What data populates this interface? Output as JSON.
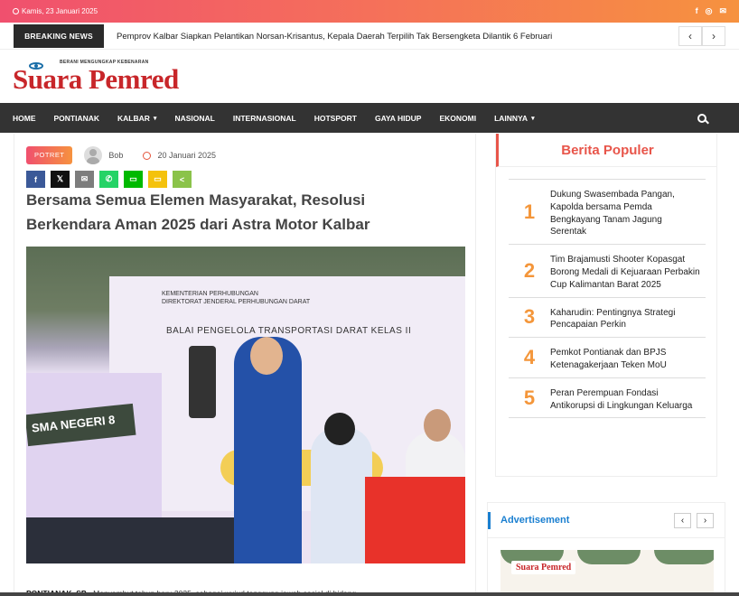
{
  "topbar": {
    "date": "Kamis, 23 Januari 2025",
    "social": [
      "f",
      "◎",
      "✉"
    ]
  },
  "breaking": {
    "label": "BREAKING NEWS",
    "text": "Pemprov Kalbar Siapkan Pelantikan Norsan-Krisantus, Kepala Daerah Terpilih Tak Bersengketa Dilantik 6 Februari",
    "prev": "‹",
    "next": "›"
  },
  "logo": {
    "tagline": "BERANI MENGUNGKAP KEBENARAN",
    "name": "Suara Pemred"
  },
  "nav": {
    "items": [
      {
        "label": "HOME"
      },
      {
        "label": "PONTIANAK"
      },
      {
        "label": "KALBAR",
        "dropdown": "▾"
      },
      {
        "label": "NASIONAL"
      },
      {
        "label": "INTERNASIONAL"
      },
      {
        "label": "HOTSPORT"
      },
      {
        "label": "GAYA HIDUP"
      },
      {
        "label": "EKONOMI"
      },
      {
        "label": "LAINNYA",
        "dropdown": "▾"
      }
    ]
  },
  "article": {
    "category": "POTRET",
    "author": "Bob",
    "date": "20 Januari 2025",
    "share": [
      {
        "icon": "facebook-icon",
        "glyph": "f",
        "color": "#3b5998"
      },
      {
        "icon": "x-icon",
        "glyph": "𝕏",
        "color": "#111111"
      },
      {
        "icon": "email-icon",
        "glyph": "✉",
        "color": "#7d7d7d"
      },
      {
        "icon": "whatsapp-icon",
        "glyph": "✆",
        "color": "#25d366"
      },
      {
        "icon": "line-icon",
        "glyph": "▭",
        "color": "#00b900"
      },
      {
        "icon": "sms-icon",
        "glyph": "▭",
        "color": "#f4c20d"
      },
      {
        "icon": "share-icon",
        "glyph": "<",
        "color": "#8bc34a"
      }
    ],
    "headline": "Bersama Semua Elemen Masyarakat, Resolusi Berkendara Aman 2025 dari Astra Motor Kalbar",
    "photo": {
      "banner_line1": "KEMENTERIAN PERHUBUNGAN",
      "banner_line2": "DIREKTORAT JENDERAL PERHUBUNGAN DARAT",
      "banner_title": "BALAI PENGELOLA TRANSPORTASI DARAT KELAS II",
      "sign": "SMA NEGERI 8"
    },
    "body_lead": "PONTIANAK, SP",
    "body_rest": " - Menyambut tahun baru 2025, sebagai wujud tanggung jawab sosial di bidang..."
  },
  "popular": {
    "title": "Berita Populer",
    "items": [
      {
        "num": "1",
        "title": "Dukung Swasembada Pangan, Kapolda bersama Pemda Bengkayang Tanam Jagung Serentak"
      },
      {
        "num": "2",
        "title": "Tim Brajamusti Shooter Kopasgat Borong Medali di Kejuaraan Perbakin Cup Kalimantan Barat 2025"
      },
      {
        "num": "3",
        "title": "Kaharudin: Pentingnya Strategi Pencapaian Perkin"
      },
      {
        "num": "4",
        "title": "Pemkot Pontianak dan BPJS Ketenagakerjaan Teken MoU"
      },
      {
        "num": "5",
        "title": "Peran Perempuan Fondasi Antikorupsi di Lingkungan Keluarga"
      }
    ]
  },
  "advertisement": {
    "title": "Advertisement",
    "prev": "‹",
    "next": "›",
    "logo": "Suara Pemred"
  }
}
